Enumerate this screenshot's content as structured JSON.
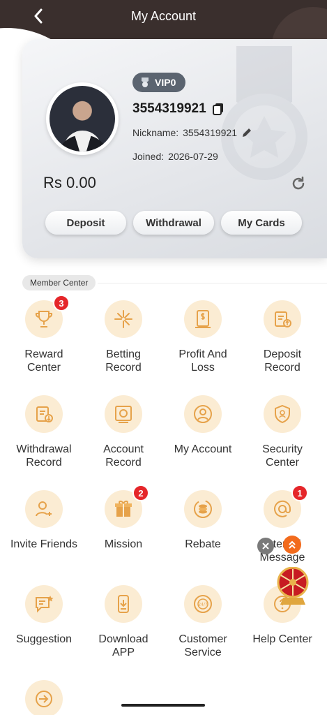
{
  "header": {
    "title": "My Account"
  },
  "profile": {
    "vip_label": "VIP0",
    "uid": "3554319921",
    "nickname_label": "Nickname:",
    "nickname": "3554319921",
    "joined_label": "Joined:",
    "joined_date": "2026-07-29",
    "balance": "Rs 0.00"
  },
  "actions": {
    "deposit": "Deposit",
    "withdrawal": "Withdrawal",
    "my_cards": "My Cards"
  },
  "member_center": {
    "title": "Member Center",
    "items": [
      {
        "label": "Reward\nCenter",
        "icon": "trophy-icon",
        "badge": "3"
      },
      {
        "label": "Betting\nRecord",
        "icon": "betting-icon"
      },
      {
        "label": "Profit And\nLoss",
        "icon": "profit-icon"
      },
      {
        "label": "Deposit\nRecord",
        "icon": "deposit-record-icon"
      },
      {
        "label": "Withdrawal\nRecord",
        "icon": "withdrawal-record-icon"
      },
      {
        "label": "Account\nRecord",
        "icon": "account-record-icon"
      },
      {
        "label": "My Account",
        "icon": "user-icon"
      },
      {
        "label": "Security\nCenter",
        "icon": "shield-icon"
      },
      {
        "label": "Invite Friends",
        "icon": "invite-icon"
      },
      {
        "label": "Mission",
        "icon": "gift-icon",
        "badge": "2"
      },
      {
        "label": "Rebate",
        "icon": "rebate-icon"
      },
      {
        "label": "Internal\nMessage",
        "icon": "at-icon",
        "badge": "1"
      },
      {
        "label": "Suggestion",
        "icon": "suggestion-icon"
      },
      {
        "label": "Download\nAPP",
        "icon": "download-icon"
      },
      {
        "label": "Customer\nService",
        "icon": "support-icon"
      },
      {
        "label": "Help Center",
        "icon": "help-icon"
      },
      {
        "label": "",
        "icon": "logout-icon"
      }
    ]
  },
  "colors": {
    "accent": "#e6a24a",
    "badge": "#e5262a",
    "icon_bg": "#fbecd3"
  }
}
